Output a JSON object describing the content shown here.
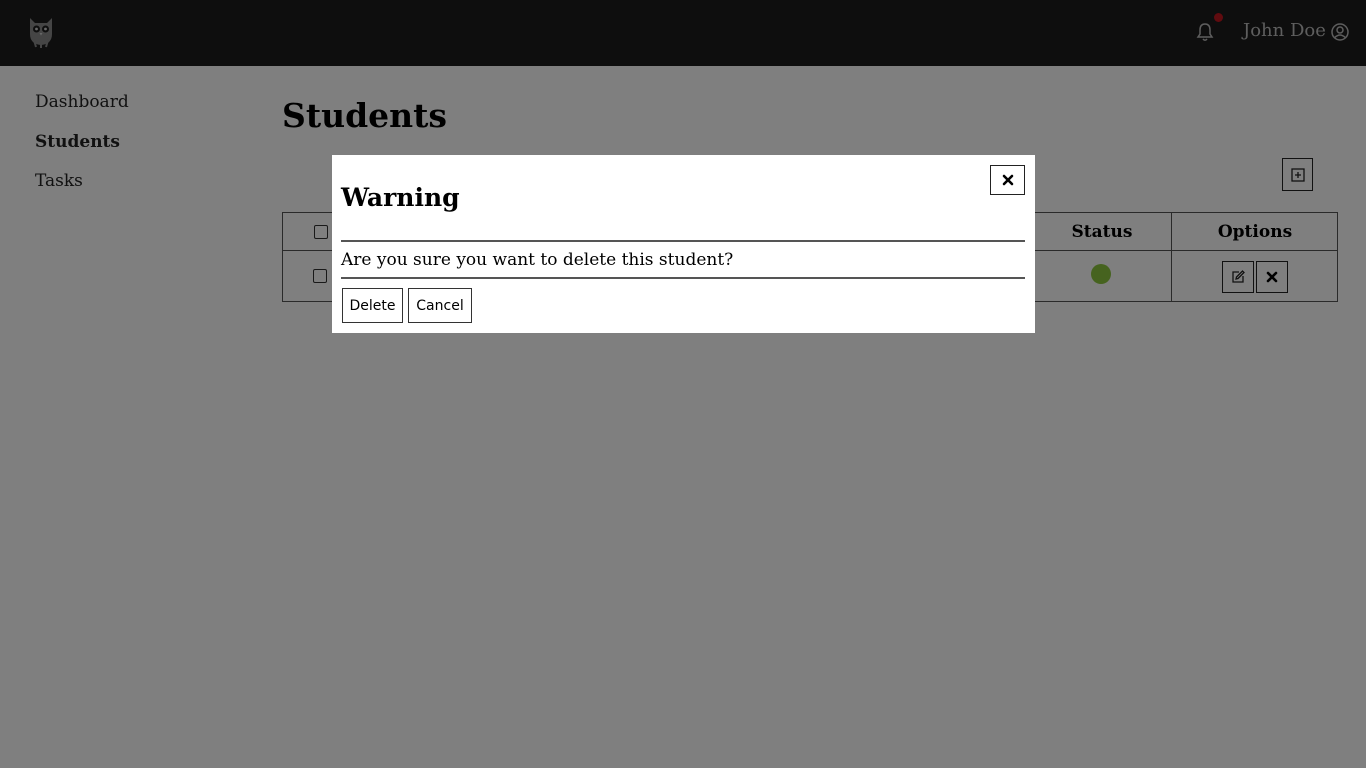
{
  "header": {
    "username": "John Doe",
    "logo_icon": "owl-logo-icon",
    "notification_icon": "bell-icon",
    "notification_dot_color": "#c0161f",
    "user_icon": "user-circle-icon"
  },
  "sidebar": {
    "items": [
      {
        "label": "Dashboard",
        "active": false
      },
      {
        "label": "Students",
        "active": true
      },
      {
        "label": "Tasks",
        "active": false
      }
    ]
  },
  "main": {
    "title": "Students",
    "add_button_icon": "plus-square-icon",
    "table": {
      "columns": [
        "Status",
        "Options"
      ],
      "rows": [
        {
          "status_color": "#8cc63f",
          "options": [
            "edit-icon",
            "delete-icon"
          ]
        }
      ]
    }
  },
  "modal": {
    "title": "Warning",
    "message": "Are you sure you want to delete this student?",
    "delete_label": "Delete",
    "cancel_label": "Cancel",
    "close_icon": "close-icon"
  }
}
